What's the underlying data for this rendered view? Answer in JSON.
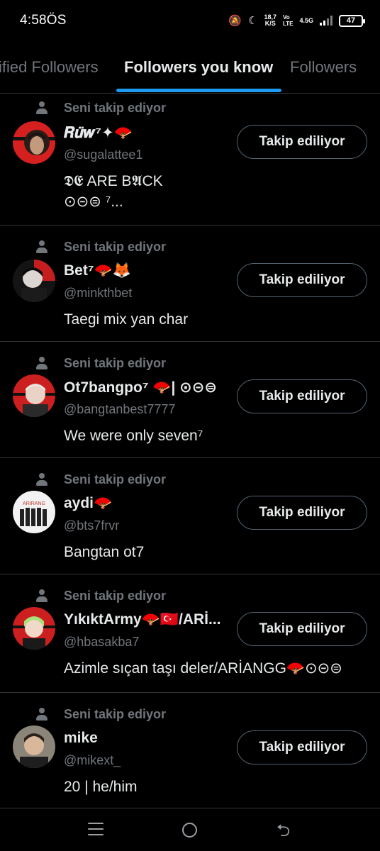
{
  "status": {
    "time": "4:58ÖS",
    "speed_value": "18,7",
    "speed_unit": "K/S",
    "net_top": "Vo",
    "net_bottom": "LTE",
    "net_type": "4.5G",
    "battery": "47",
    "mute_icon": "bell-off-icon",
    "dnd_icon": "moon-icon"
  },
  "tabs": [
    {
      "label": "ified Followers",
      "active": false
    },
    {
      "label": "Followers you know",
      "active": true
    },
    {
      "label": "Followers",
      "active": false
    }
  ],
  "accent_color": "#1d9bf0",
  "followers": [
    {
      "context": "Seni takip ediyor",
      "name": "𝑹𝒖̈𝒘⁷✦🪭",
      "handle": "@sugalattee1",
      "bio": "𝕯𝕰 ARE B𝕬CK\n⊙⊝⊜ ⁷...",
      "button": "Takip ediliyor"
    },
    {
      "context": "Seni takip ediyor",
      "name": "Bet⁷🪭🦊",
      "handle": "@minkthbet",
      "bio": "Taegi mix yan char",
      "button": "Takip ediliyor"
    },
    {
      "context": "Seni takip ediyor",
      "name": "Ot7bangpo⁷ 🪭| ⊙⊝⊜",
      "handle": "@bangtanbest7777",
      "bio": "We were only seven⁷",
      "button": "Takip ediliyor"
    },
    {
      "context": "Seni takip ediyor",
      "name": "aydi🪭",
      "handle": "@bts7frvr",
      "bio": "Bangtan ot7",
      "button": "Takip ediliyor"
    },
    {
      "context": "Seni takip ediyor",
      "name": "YıkıktArmy🪭🇹🇷/ARİ...",
      "handle": "@hbasakba7",
      "bio": "Azimle sıçan taşı deler/ARİANGG🪭⊙⊝⊜",
      "button": "Takip ediliyor"
    },
    {
      "context": "Seni takip ediyor",
      "name": "mike",
      "handle": "@mikext_",
      "bio": "20 | he/him",
      "button": "Takip ediliyor"
    }
  ],
  "nav": {
    "menu_icon": "recent-apps-icon",
    "home_icon": "home-circle-icon",
    "back_icon": "back-arrow-icon",
    "back_glyph": "⮌"
  }
}
